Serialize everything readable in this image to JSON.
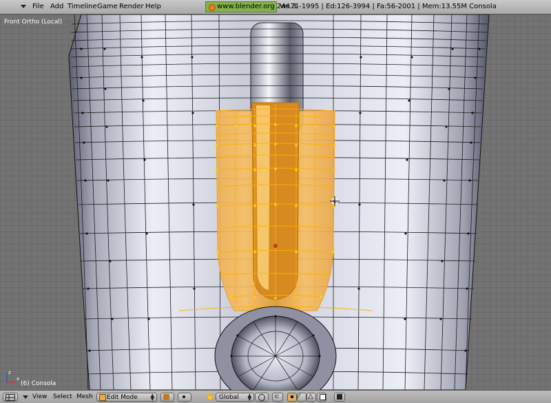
{
  "top_menu": {
    "items": [
      "File",
      "Add",
      "Timeline",
      "Game",
      "Render",
      "Help"
    ],
    "info_url": "www.blender.org 244.3",
    "stats": "Ve:71-1995 | Ed:126-3994 | Fa:56-2001 | Mem:13.55M Consola"
  },
  "viewport": {
    "view_name": "Front Ortho (Local)",
    "object_label": "(6) Consola",
    "selection_color": "#f3a840",
    "mesh_color": "#c8cad8",
    "vertex_color": "#111111",
    "selected_vertex_color": "#ffd21a"
  },
  "bottom_bar": {
    "menus": [
      "View",
      "Select",
      "Mesh"
    ],
    "mode": "Edit Mode",
    "orientation": "Global"
  },
  "icons": [
    "window-type-icon",
    "blender-logo-icon",
    "axis-gizmo-icon",
    "3d-cursor-icon",
    "draw-type-icon",
    "hand-icon",
    "vertex-select-icon",
    "edge-select-icon",
    "face-select-icon",
    "render-icon"
  ]
}
